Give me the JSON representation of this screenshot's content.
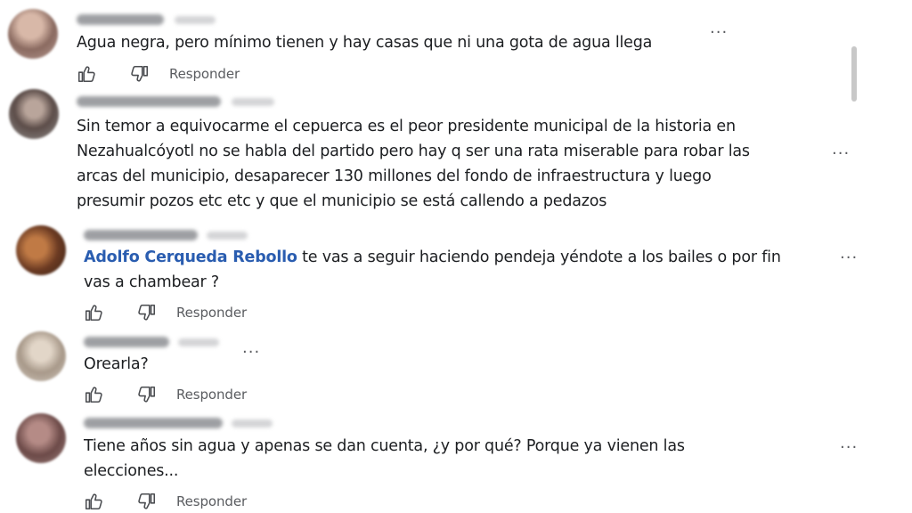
{
  "comments": [
    {
      "text": "Agua negra, pero mínimo tienen y hay casas que ni una gota de agua llega",
      "reply_label": "Responder"
    },
    {
      "lines": [
        "Sin temor a equivocarme el cepuerca es el peor presidente municipal de la historia en",
        "Nezahualcóyotl no se habla del partido pero hay q ser una rata miserable para robar las",
        "arcas del municipio, desaparecer 130 millones del fondo de infraestructura y luego",
        "presumir pozos etc etc y que el municipio se está callendo a pedazos"
      ]
    },
    {
      "mention": "Adolfo Cerqueda Rebollo",
      "line1": " te vas a seguir haciendo pendeja yéndote a los bailes o por fin",
      "line2": "vas a chambear ?",
      "reply_label": "Responder"
    },
    {
      "text": "Orearla?",
      "reply_label": "Responder"
    },
    {
      "line1": "Tiene años sin agua y apenas se dan cuenta, ¿y por qué? Porque ya vienen las",
      "line2": "elecciones...",
      "reply_label": "Responder"
    }
  ],
  "more_label": "···",
  "icons": {
    "like": "thumbs-up-icon",
    "dislike": "thumbs-down-icon",
    "more": "more-options-icon"
  },
  "colors": {
    "mention": "#2a5db0",
    "text": "#1c1e21",
    "secondary": "#5a5c60"
  }
}
